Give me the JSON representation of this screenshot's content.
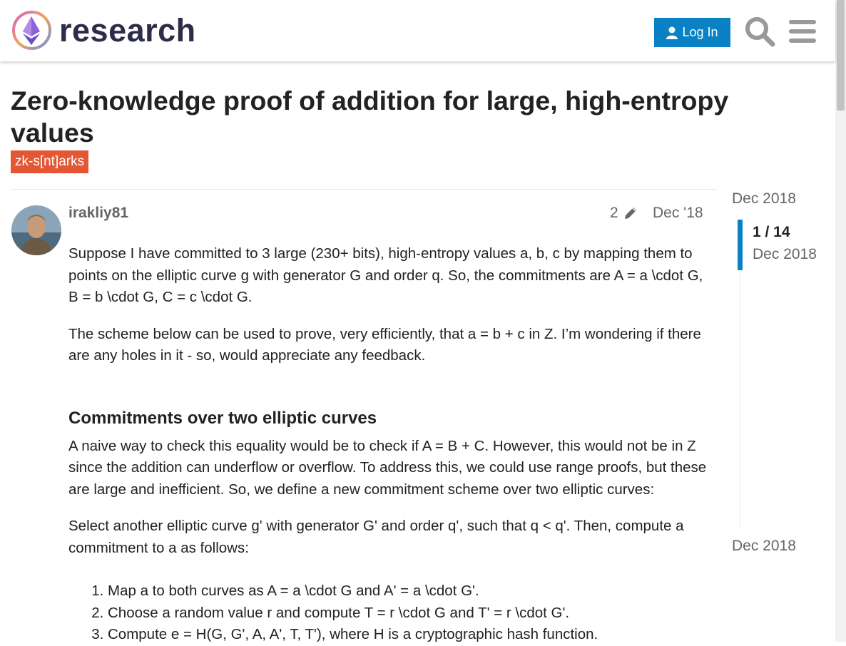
{
  "header": {
    "site_name": "research",
    "login_label": "Log In",
    "brand_color": "#0a81c4"
  },
  "topic": {
    "title": "Zero-knowledge proof of addition for large, high-entropy values",
    "tag": "zk-s[nt]arks",
    "tag_color": "#e45735"
  },
  "post": {
    "username": "irakliy81",
    "edit_count": "2",
    "date": "Dec '18",
    "paragraphs": [
      "Suppose I have committed to 3 large (230+ bits), high-entropy values a, b, c by mapping them to points on the elliptic curve g with generator G and order q. So, the commitments are A = a \\cdot G, B = b \\cdot G, C = c \\cdot G.",
      "The scheme below can be used to prove, very efficiently, that a = b + c in Z. I’m wondering if there are any holes in it - so, would appreciate any feedback."
    ],
    "heading": "Commitments over two elliptic curves",
    "paragraphs2": [
      "A naive way to check this equality would be to check if A = B + C. However, this would not be in Z since the addition can underflow or overflow. To address this, we could use range proofs, but these are large and inefficient. So, we define a new commitment scheme over two elliptic curves:",
      "Select another elliptic curve g' with generator G' and order q', such that q < q'. Then, compute a commitment to a as follows:"
    ],
    "steps": [
      "Map a to both curves as A = a \\cdot G and A' = a \\cdot G'.",
      "Choose a random value r and compute T = r \\cdot G and T' = r \\cdot G'.",
      "Compute e = H(G, G', A, A', T, T'), where H is a cryptographic hash function."
    ]
  },
  "timeline": {
    "start_date": "Dec 2018",
    "position": "1 / 14",
    "current_date": "Dec 2018",
    "end_date": "Dec 2018"
  }
}
